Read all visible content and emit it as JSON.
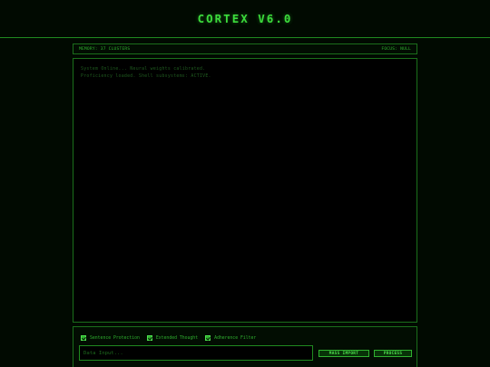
{
  "app": {
    "title": "CORTEX V6.0"
  },
  "status_bar": {
    "memory": "MEMORY: 37 CLUSTERS",
    "focus": "FOCUS: NULL"
  },
  "console": {
    "lines": [
      "System Online... Neural weights calibrated.",
      "Proficiency loaded. Shell subsystems: ACTIVE."
    ]
  },
  "controls": {
    "options": [
      {
        "label": "Sentence Protection",
        "checked": true
      },
      {
        "label": "Extended Thought",
        "checked": true
      },
      {
        "label": "Adherence Filter",
        "checked": true
      }
    ],
    "input": {
      "value": "",
      "placeholder": "Data Input..."
    },
    "mass_import_label": "MASS IMPORT",
    "process_label": "PROCESS"
  },
  "colors": {
    "background": "#010a01",
    "accent": "#3cdc3c",
    "border": "#1b6e1b",
    "dim_text": "#1f5a1f"
  }
}
